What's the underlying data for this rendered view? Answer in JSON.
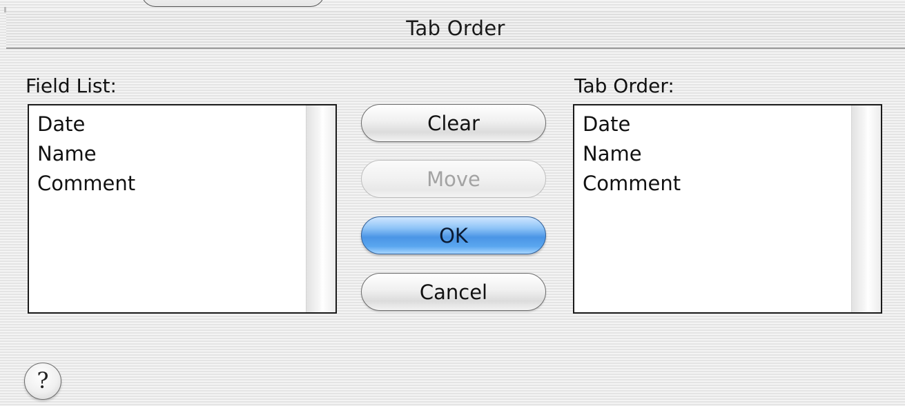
{
  "dialog": {
    "title": "Tab Order"
  },
  "field_list": {
    "label": "Field List:",
    "items": [
      "Date",
      "Name",
      "Comment"
    ]
  },
  "tab_order": {
    "label": "Tab Order:",
    "items": [
      "Date",
      "Name",
      "Comment"
    ]
  },
  "buttons": {
    "clear": "Clear",
    "move": "Move",
    "ok": "OK",
    "cancel": "Cancel"
  },
  "help": {
    "glyph": "?",
    "icon": "help-icon"
  },
  "colors": {
    "default_button": "#4b95e6",
    "disabled_text": "#a3a3a3"
  }
}
